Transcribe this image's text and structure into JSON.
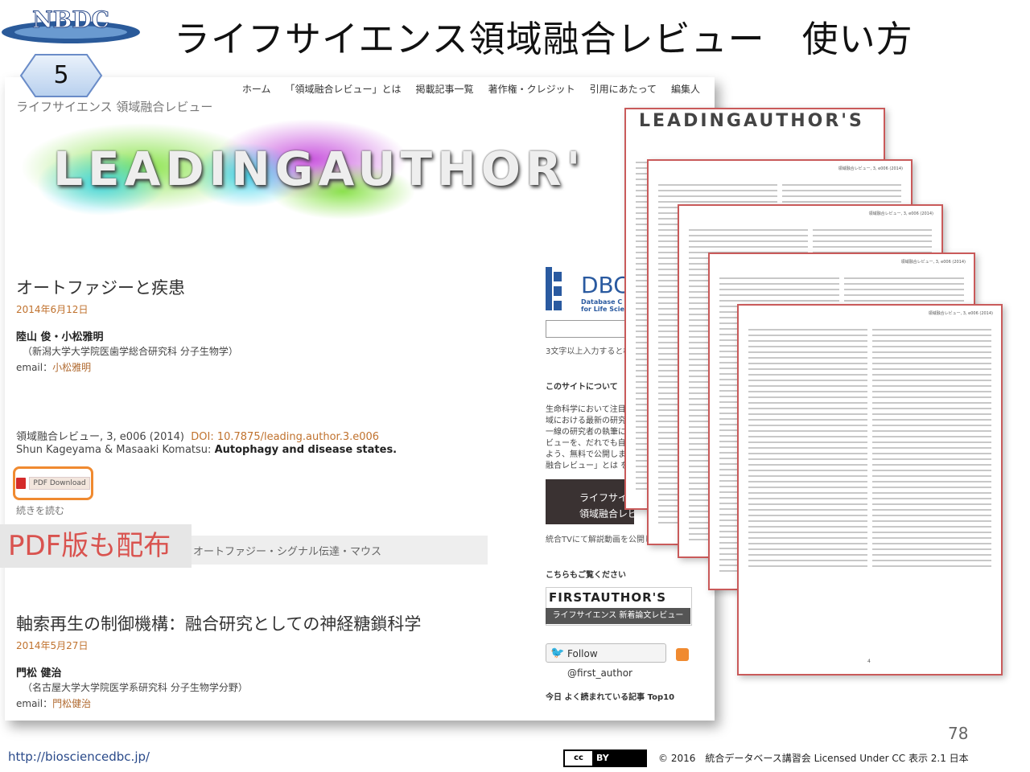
{
  "slide": {
    "title": "ライフサイエンス領域融合レビュー　使い方",
    "logo_text": "NBDC",
    "step": "5",
    "callout": "PDF版も配布",
    "page_number": "78",
    "footer_url": "http://biosciencedbc.jp/",
    "license": "© 2016　統合データベース講習会 Licensed Under CC 表示 2.1 日本",
    "cc_label": "cc",
    "by_label": "BY"
  },
  "site": {
    "nav": [
      "ホーム",
      "「領域融合レビュー」とは",
      "掲載記事一覧",
      "著作権・クレジット",
      "引用にあたって",
      "編集人"
    ],
    "subtitle": "ライフサイエンス 領域融合レビュー",
    "banner_text": "LEADINGAUTHOR'",
    "articles": [
      {
        "title": "オートファジーと疾患",
        "date": "2014年6月12日",
        "authors": "陸山 俊・小松雅明",
        "affiliation": "（新潟大学大学院医歯学総合研究科 分子生物学）",
        "email_label": "email：",
        "email_link": "小松雅明"
      },
      {
        "title": "軸索再生の制御機構：融合研究としての神経糖鎖科学",
        "date": "2014年5月27日",
        "authors": "門松 健治",
        "affiliation": "（名古屋大学大学院医学系研究科 分子生物学分野）",
        "email_label": "email：",
        "email_link": "門松健治"
      }
    ],
    "citation_prefix": "領域融合レビュー, 3, e006 (2014)",
    "citation_doi": "DOI: 10.7875/leading.author.3.e006",
    "citation_authors": "Shun Kageyama & Masaaki Komatsu:",
    "citation_title": "Autophagy and disease states.",
    "pdf_button": "PDF Download",
    "read_more": "続きを読む",
    "tags": "オートファジー・シグナル伝達・マウス",
    "sidebar": {
      "dbcls_name": "DBC",
      "dbcls_sub": "Database C\nfor Life Scie",
      "search_hint": "3文字以上入力すると検",
      "about_heading": "このサイトについて",
      "about_lines": [
        "生命科学において注目",
        "域における最新の研究",
        "一線の研究者の執筆に",
        "ビューを、だれでも自由",
        "よう、無料で公開しま",
        "融合レビュー」とは をご"
      ],
      "tv_line1": "ライフサイエン",
      "tv_line2": "領域融合レビュ",
      "tv_caption": "統合TVにて解説動画を公開しました",
      "see_also": "こちらもご覧ください",
      "first_author_title": "FIRSTAUTHOR'S",
      "first_author_sub": "ライフサイエンス 新着論文レビュー",
      "follow_label": "Follow @first_author",
      "popular_heading": "今日 よく読まれている記事 Top10"
    }
  },
  "pdf_pages": {
    "page1_title": "LEADINGAUTHOR'S",
    "header_text": "領域融合レビュー, 3, e006 (2014)",
    "last_page_number": "4"
  }
}
